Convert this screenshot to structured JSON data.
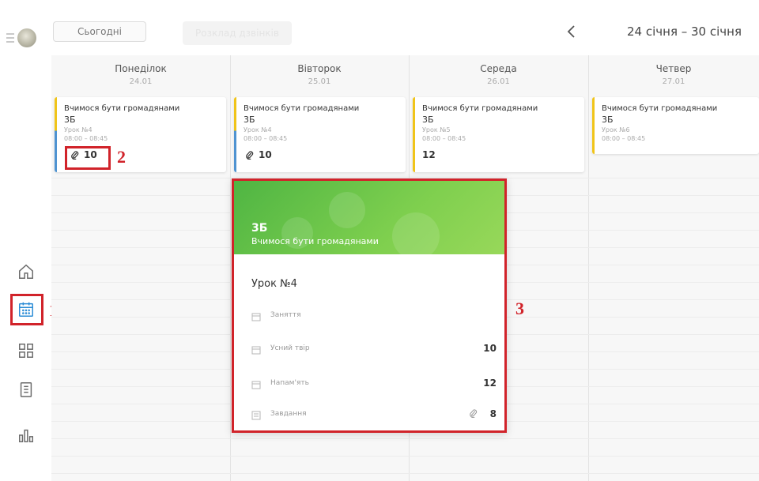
{
  "sidebar": {
    "items": [
      {
        "name": "home",
        "icon": "home-icon"
      },
      {
        "name": "calendar",
        "icon": "calendar-icon",
        "active": true
      },
      {
        "name": "apps",
        "icon": "grid-icon"
      },
      {
        "name": "journal",
        "icon": "clipboard-icon"
      },
      {
        "name": "stats",
        "icon": "bar-chart-icon"
      }
    ]
  },
  "annotations": {
    "m1": "1",
    "m2": "2",
    "m3": "3"
  },
  "toolbar": {
    "today_label": "Сьогодні",
    "ghost_label": "Розклад дзвінків",
    "date_range": "24 січня – 30 січня"
  },
  "days": [
    {
      "name": "Понеділок",
      "date": "24.01"
    },
    {
      "name": "Вівторок",
      "date": "25.01"
    },
    {
      "name": "Середа",
      "date": "26.01"
    },
    {
      "name": "Четвер",
      "date": "27.01"
    }
  ],
  "lessons": [
    {
      "title": "Вчимося бути громадянами",
      "class": "3Б",
      "number": "Урок №4",
      "time": "08:00 – 08:45",
      "score": "10",
      "attach": true
    },
    {
      "title": "Вчимося бути громадянами",
      "class": "3Б",
      "number": "Урок №4",
      "time": "08:00 – 08:45",
      "score": "10",
      "attach": true
    },
    {
      "title": "Вчимося бути громадянами",
      "class": "3Б",
      "number": "Урок №5",
      "time": "08:00 – 08:45",
      "score": "12",
      "attach": false
    },
    {
      "title": "Вчимося бути громадянами",
      "class": "3Б",
      "number": "Урок №6",
      "time": "08:00 – 08:45",
      "score": "",
      "attach": false
    }
  ],
  "popup": {
    "class": "3Б",
    "subject": "Вчимося бути громадянами",
    "lesson": "Урок №4",
    "rows": [
      {
        "label": "Заняття",
        "value": ""
      },
      {
        "label": "Усний твір",
        "value": "10"
      },
      {
        "label": "Напам'ять",
        "value": "12"
      },
      {
        "label": "Завдання",
        "value": "8",
        "attach": true
      }
    ]
  },
  "colors": {
    "accent_red": "#d1232a",
    "stripe_yellow": "#f0c419",
    "stripe_blue": "#4f93d1",
    "popup_green": "#6cc24a"
  }
}
